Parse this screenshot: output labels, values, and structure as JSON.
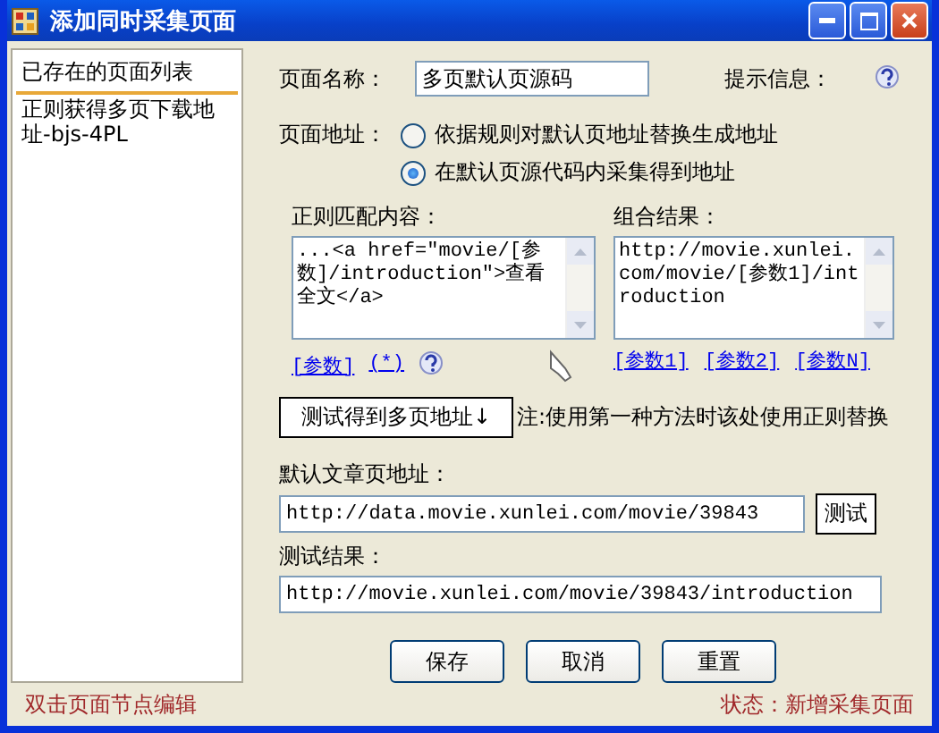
{
  "window": {
    "title": "添加同时采集页面",
    "controls": [
      {
        "kind": "minimize"
      },
      {
        "kind": "maximize"
      },
      {
        "kind": "close"
      }
    ]
  },
  "sidebar": {
    "header": "已存在的页面列表",
    "items": [
      {
        "label": "正则获得多页下载地址-bjs-4PL",
        "selected": false
      }
    ],
    "hint": "双击页面节点编辑"
  },
  "form": {
    "page_name": {
      "label": "页面名称：",
      "value": "多页默认页源码"
    },
    "tip": {
      "label": "提示信息："
    },
    "address": {
      "label": "页面地址：",
      "options": [
        {
          "label": "依据规则对默认页地址替换生成地址",
          "selected": false
        },
        {
          "label": "在默认页源代码内采集得到地址",
          "selected": true
        }
      ]
    },
    "regex": {
      "label": "正则匹配内容：",
      "value": "...<a href=\"movie/[参数]/introduction\">查看全文</a>",
      "links": [
        "[参数]",
        "(*)"
      ]
    },
    "combined": {
      "label": "组合结果：",
      "value": "http://movie.xunlei.com/movie/[参数1]/introduction",
      "links": [
        "[参数1]",
        "[参数2]",
        "[参数N]"
      ]
    },
    "test_button": "测试得到多页地址↓",
    "note": "注:使用第一种方法时该处使用正则替换",
    "default_url": {
      "label": "默认文章页地址：",
      "value": "http://data.movie.xunlei.com/movie/39843",
      "button": "测试"
    },
    "test_result": {
      "label": "测试结果：",
      "value": "http://movie.xunlei.com/movie/39843/introduction"
    },
    "buttons": [
      "保存",
      "取消",
      "重置"
    ]
  },
  "status_bar": {
    "text": "状态：新增采集页面"
  }
}
